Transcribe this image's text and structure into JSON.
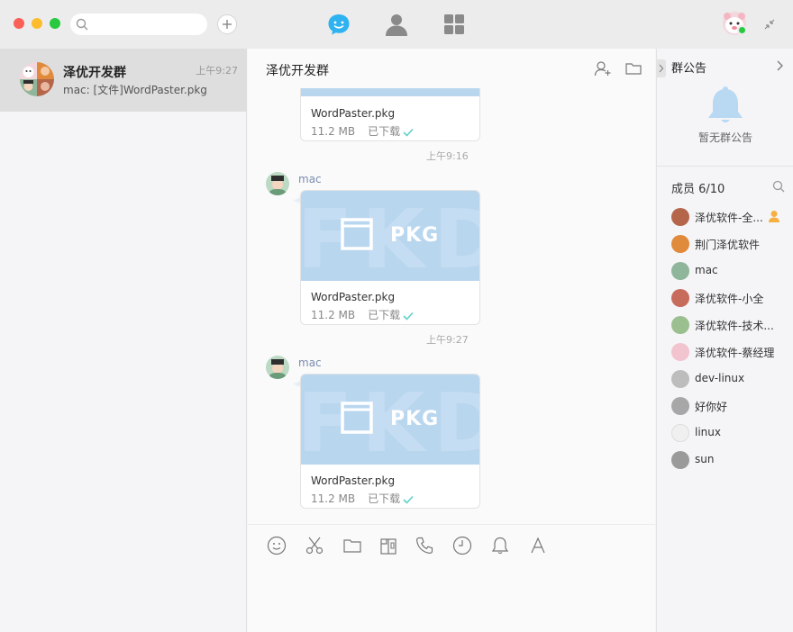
{
  "toolbar": {
    "search_placeholder": "",
    "add_label": "+"
  },
  "conversations": [
    {
      "name": "泽优开发群",
      "time": "上午9:27",
      "preview": "mac: [文件]WordPaster.pkg"
    }
  ],
  "chat": {
    "title": "泽优开发群",
    "messages": [
      {
        "file_name": "WordPaster.pkg",
        "size": "11.2 MB",
        "status": "已下载",
        "time": "上午9:16"
      },
      {
        "sender": "mac",
        "ext": "PKG",
        "file_name": "WordPaster.pkg",
        "size": "11.2 MB",
        "status": "已下载",
        "time": "上午9:27"
      },
      {
        "sender": "mac",
        "ext": "PKG",
        "file_name": "WordPaster.pkg",
        "size": "11.2 MB",
        "status": "已下载"
      }
    ],
    "tools": [
      "emoji-icon",
      "scissors-icon",
      "folder-icon",
      "gift-icon",
      "phone-icon",
      "clock-icon",
      "bell-icon",
      "font-icon"
    ]
  },
  "group": {
    "notice_title": "群公告",
    "notice_empty": "暂无群公告",
    "members_title": "成员 6/10",
    "members": [
      {
        "name": "泽优软件-全...",
        "color": "#b5654a",
        "badge": "owner-icon"
      },
      {
        "name": "荆门泽优软件",
        "color": "#e08a3c"
      },
      {
        "name": "mac",
        "color": "#8fb59a"
      },
      {
        "name": "泽优软件-小全",
        "color": "#c76b5d"
      },
      {
        "name": "泽优软件-技术...",
        "color": "#9cbf8f"
      },
      {
        "name": "泽优软件-蔡经理",
        "color": "#f2c4cf"
      },
      {
        "name": "dev-linux",
        "color": "#bdbdbd"
      },
      {
        "name": "好你好",
        "color": "#a7a7a7"
      },
      {
        "name": "linux",
        "color": "#f0f0f0"
      },
      {
        "name": "sun",
        "color": "#9a9a9a"
      }
    ]
  },
  "colors": {
    "accent": "#2fb3f0",
    "download_check": "#5fd0c9",
    "file_thumb": "#b9d6ef"
  }
}
